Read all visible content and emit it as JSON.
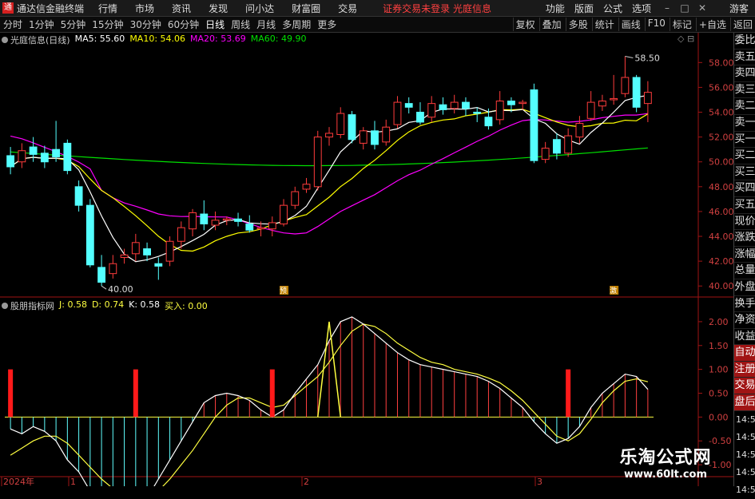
{
  "titlebar": {
    "app_title": "通达信金融终端",
    "menus": [
      "行情",
      "市场",
      "资讯",
      "发现",
      "问小达",
      "财富圈",
      "交易"
    ],
    "notice": "证券交易未登录  光庭信息",
    "right_menus": [
      "功能",
      "版面",
      "公式",
      "选项"
    ],
    "guest": "游客"
  },
  "toolbar": {
    "periods": [
      "分时",
      "1分钟",
      "5分钟",
      "15分钟",
      "30分钟",
      "60分钟",
      "日线",
      "周线",
      "月线",
      "多周期",
      "更多"
    ],
    "active": "日线",
    "buttons": [
      "复权",
      "叠加",
      "多股",
      "统计",
      "画线",
      "F10",
      "标记",
      "+自选",
      "返回"
    ]
  },
  "main_info": {
    "stock": "光庭信息(日线)",
    "ma5": "MA5: 55.60",
    "ma10": "MA10: 54.06",
    "ma20": "MA20: 53.69",
    "ma60": "MA60: 49.90"
  },
  "sub_info": {
    "name": "股朋指标网",
    "j": "J: 0.58",
    "d": "D: 0.74",
    "k": "K: 0.58",
    "buy": "买入: 0.00"
  },
  "sidebar": {
    "quote_labels": [
      "委比",
      "卖五",
      "卖四",
      "卖三",
      "卖二",
      "卖一",
      "买一",
      "买二",
      "买三",
      "买四",
      "买五",
      "现价",
      "涨跌",
      "涨幅",
      "总量",
      "外盘",
      "换手",
      "净资",
      "收益"
    ],
    "trade_labels": [
      "自动",
      "注册",
      "交易",
      "盘后"
    ],
    "times": [
      "14:56",
      "14:56",
      "14:56",
      "14:56",
      "14:56"
    ]
  },
  "markers": {
    "high_label": "58.50",
    "low_label": "40.00",
    "mark_a": "预",
    "mark_b": "激"
  },
  "axis": {
    "x_labels": [
      "2024年",
      "1",
      "2",
      "3"
    ]
  },
  "watermark": {
    "title": "乐淘公式网",
    "url": "www.60lt.com"
  },
  "colors": {
    "up": "#ff3c3c",
    "down": "#54ffff",
    "ma5": "#ffffff",
    "ma10": "#ffff00",
    "ma20": "#ff00ff",
    "ma60": "#00e000",
    "k": "#ffffff",
    "d": "#ffff40"
  },
  "chart_data": [
    {
      "type": "candlestick",
      "title": "光庭信息(日线)",
      "ylim": [
        39.5,
        59.5
      ],
      "y_ticks": [
        40,
        42,
        44,
        46,
        48,
        50,
        52,
        54,
        56,
        58
      ],
      "candles": [
        [
          50.5,
          49.6,
          51.2,
          49.0
        ],
        [
          50.0,
          50.9,
          51.5,
          49.5
        ],
        [
          51.2,
          50.6,
          52.0,
          50.0
        ],
        [
          50.7,
          50.0,
          51.3,
          49.5
        ],
        [
          51.0,
          50.4,
          53.3,
          50.0
        ],
        [
          51.5,
          49.3,
          51.8,
          49.0
        ],
        [
          48.0,
          46.5,
          48.5,
          46.0
        ],
        [
          46.5,
          41.7,
          47.0,
          41.5
        ],
        [
          41.5,
          40.3,
          42.5,
          40.0
        ],
        [
          41.0,
          41.8,
          42.5,
          40.6
        ],
        [
          42.3,
          42.5,
          43.0,
          41.8
        ],
        [
          42.6,
          43.5,
          44.2,
          42.0
        ],
        [
          43.0,
          42.5,
          43.5,
          42.0
        ],
        [
          41.8,
          41.6,
          42.3,
          40.5
        ],
        [
          42.0,
          43.6,
          44.0,
          41.6
        ],
        [
          43.6,
          44.7,
          45.2,
          43.0
        ],
        [
          44.6,
          45.9,
          46.2,
          44.0
        ],
        [
          45.8,
          45.0,
          46.9,
          44.5
        ],
        [
          44.9,
          45.3,
          46.0,
          44.5
        ],
        [
          45.3,
          45.4,
          45.6,
          44.9
        ],
        [
          45.4,
          45.2,
          45.9,
          44.8
        ],
        [
          45.0,
          44.5,
          45.7,
          44.3
        ],
        [
          44.6,
          44.7,
          45.2,
          44.0
        ],
        [
          44.6,
          45.1,
          45.6,
          44.0
        ],
        [
          45.0,
          46.5,
          47.0,
          44.8
        ],
        [
          46.5,
          47.6,
          48.0,
          46.2
        ],
        [
          47.8,
          48.2,
          48.7,
          47.5
        ],
        [
          48.0,
          52.0,
          52.5,
          47.7
        ],
        [
          52.0,
          52.3,
          52.8,
          51.3
        ],
        [
          52.2,
          53.9,
          54.4,
          51.9
        ],
        [
          53.8,
          51.8,
          54.1,
          51.5
        ],
        [
          51.5,
          52.5,
          52.8,
          51.0
        ],
        [
          52.5,
          51.4,
          53.3,
          51.0
        ],
        [
          51.6,
          52.8,
          53.4,
          51.3
        ],
        [
          53.0,
          54.8,
          55.3,
          52.7
        ],
        [
          54.7,
          54.4,
          55.2,
          53.9
        ],
        [
          54.0,
          53.2,
          54.8,
          53.0
        ],
        [
          53.6,
          54.7,
          55.3,
          53.2
        ],
        [
          54.6,
          54.2,
          55.2,
          53.8
        ],
        [
          54.3,
          54.8,
          55.4,
          53.9
        ],
        [
          54.8,
          54.3,
          55.2,
          53.7
        ],
        [
          54.0,
          53.9,
          54.4,
          53.2
        ],
        [
          53.6,
          52.9,
          54.3,
          52.6
        ],
        [
          53.4,
          54.9,
          55.7,
          53.0
        ],
        [
          54.9,
          54.6,
          55.2,
          54.0
        ],
        [
          54.7,
          54.8,
          55.0,
          54.2
        ],
        [
          55.8,
          50.1,
          56.3,
          49.9
        ],
        [
          50.2,
          51.1,
          51.6,
          49.9
        ],
        [
          51.8,
          50.7,
          52.3,
          50.2
        ],
        [
          50.7,
          52.1,
          52.7,
          50.4
        ],
        [
          52.0,
          53.1,
          53.7,
          51.5
        ],
        [
          53.5,
          54.8,
          55.7,
          53.3
        ],
        [
          54.5,
          54.9,
          55.4,
          54.1
        ],
        [
          55.0,
          55.1,
          57.0,
          54.6
        ],
        [
          55.5,
          56.8,
          58.5,
          55.2
        ],
        [
          56.8,
          54.4,
          57.0,
          54.0
        ],
        [
          54.7,
          55.6,
          56.5,
          53.2
        ]
      ]
    },
    {
      "type": "line",
      "title": "股朋指标网",
      "ylim": [
        -1.3,
        2.3
      ],
      "y_ticks": [
        2.0,
        1.5,
        1.0,
        0.5,
        0.0,
        -0.5,
        -1.0
      ],
      "buy_signal_indices": [
        0,
        11,
        23,
        49
      ],
      "k": [
        -0.25,
        -0.35,
        -0.2,
        -0.3,
        -0.5,
        -0.9,
        -1.15,
        -1.55,
        -1.8,
        -2.1,
        -2.15,
        -2.0,
        -1.7,
        -1.3,
        -0.9,
        -0.5,
        -0.1,
        0.3,
        0.45,
        0.5,
        0.45,
        0.35,
        0.15,
        0.0,
        0.15,
        0.5,
        0.8,
        1.1,
        1.6,
        2.0,
        2.1,
        1.95,
        1.75,
        1.55,
        1.35,
        1.2,
        1.1,
        1.05,
        1.0,
        0.95,
        0.9,
        0.85,
        0.75,
        0.6,
        0.4,
        0.2,
        -0.1,
        -0.35,
        -0.55,
        -0.45,
        -0.2,
        0.2,
        0.5,
        0.7,
        0.9,
        0.85,
        0.58
      ],
      "d": [
        -0.8,
        -0.65,
        -0.5,
        -0.4,
        -0.4,
        -0.55,
        -0.8,
        -1.05,
        -1.3,
        -1.5,
        -1.7,
        -1.8,
        -1.75,
        -1.55,
        -1.3,
        -1.0,
        -0.7,
        -0.35,
        0.0,
        0.25,
        0.4,
        0.4,
        0.3,
        0.2,
        0.25,
        0.45,
        0.65,
        0.85,
        1.15,
        1.5,
        1.8,
        1.95,
        1.9,
        1.75,
        1.55,
        1.4,
        1.25,
        1.15,
        1.1,
        1.0,
        0.95,
        0.9,
        0.82,
        0.72,
        0.55,
        0.35,
        0.1,
        -0.15,
        -0.4,
        -0.5,
        -0.35,
        -0.05,
        0.3,
        0.55,
        0.75,
        0.8,
        0.74
      ],
      "buy_pulse": {
        "index": 28,
        "value": 2.0
      }
    }
  ]
}
